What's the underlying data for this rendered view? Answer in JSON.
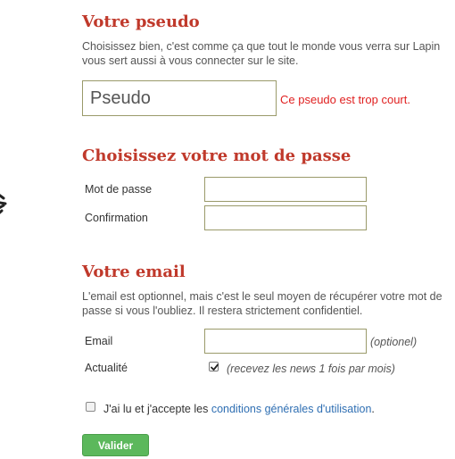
{
  "pseudo_section": {
    "title": "Votre pseudo",
    "desc_line1": "Choisissez bien, c'est comme ça que tout le monde vous verra sur Lapin",
    "desc_line2": "vous sert aussi à vous connecter sur le site.",
    "input_placeholder": "Pseudo",
    "error": "Ce pseudo est trop court."
  },
  "password_section": {
    "title": "Choisissez votre mot de passe",
    "password_label": "Mot de passe",
    "confirm_label": "Confirmation"
  },
  "email_section": {
    "title": "Votre email",
    "desc_line1": "L'email est optionnel, mais c'est le seul moyen de récupérer votre mot de",
    "desc_line2": "passe si vous l'oubliez. Il restera strictement confidentiel.",
    "email_label": "Email",
    "email_hint": "(optionel)",
    "news_label": "Actualité",
    "news_hint": "(recevez les news 1 fois par mois)",
    "news_checked": true
  },
  "terms": {
    "text_before": "J'ai lu et j'accepte les ",
    "link": "conditions générales d'utilisation",
    "text_after": ".",
    "checked": false
  },
  "submit_label": "Valider",
  "colors": {
    "heading": "#c0392b",
    "error": "#e02020",
    "link": "#2f6fb3",
    "button": "#5cb85c"
  }
}
